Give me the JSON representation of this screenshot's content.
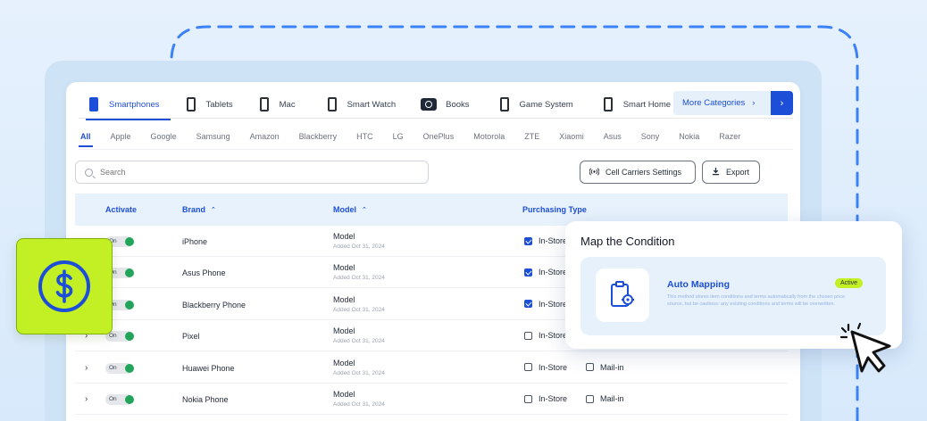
{
  "categories": [
    {
      "label": "Smartphones",
      "icon": "smartphone-icon",
      "active": true
    },
    {
      "label": "Tablets",
      "icon": "tablet-icon"
    },
    {
      "label": "Mac",
      "icon": "mac-icon"
    },
    {
      "label": "Smart Watch",
      "icon": "smartwatch-icon"
    },
    {
      "label": "Books",
      "icon": "camera-icon"
    },
    {
      "label": "Game System",
      "icon": "game-system-icon"
    },
    {
      "label": "Smart Home",
      "icon": "smart-home-icon"
    }
  ],
  "more_categories": {
    "label": "More Categories",
    "chevron": "›",
    "arrow": "›"
  },
  "brands": [
    "All",
    "Apple",
    "Google",
    "Samsung",
    "Amazon",
    "Blackberry",
    "HTC",
    "LG",
    "OnePlus",
    "Motorola",
    "ZTE",
    "Xiaomi",
    "Asus",
    "Sony",
    "Nokia",
    "Razer"
  ],
  "search": {
    "placeholder": "Search"
  },
  "actions": {
    "carrier_settings": "Cell Carriers Settings",
    "export": "Export"
  },
  "table": {
    "headers": {
      "activate": "Activate",
      "brand": "Brand",
      "model": "Model",
      "purchasing_type": "Purchasing Type"
    },
    "rows": [
      {
        "toggle": "On",
        "brand": "iPhone",
        "model": "Model",
        "added": "Added Oct 31, 2024",
        "in_store": true,
        "in_store_label": "In-Store",
        "mail_label": ""
      },
      {
        "toggle": "On",
        "brand": "Asus Phone",
        "model": "Model",
        "added": "Added Oct 31, 2024",
        "in_store": true,
        "in_store_label": "In-Store",
        "mail_label": ""
      },
      {
        "toggle": "On",
        "brand": "Blackberry Phone",
        "model": "Model",
        "added": "Added Oct 31, 2024",
        "in_store": true,
        "in_store_label": "In-Store",
        "mail_label": ""
      },
      {
        "toggle": "On",
        "brand": "Pixel",
        "model": "Model",
        "added": "Added Oct 31, 2024",
        "in_store": false,
        "in_store_label": "In-Store",
        "mail_label": ""
      },
      {
        "toggle": "On",
        "brand": "Huawei Phone",
        "model": "Model",
        "added": "Added Oct 31, 2024",
        "in_store": false,
        "in_store_label": "In-Store",
        "mail_label": "Mail-in"
      },
      {
        "toggle": "On",
        "brand": "Nokia Phone",
        "model": "Model",
        "added": "Added Oct 31, 2024",
        "in_store": false,
        "in_store_label": "In-Store",
        "mail_label": "Mail-in"
      }
    ]
  },
  "popup": {
    "title": "Map the Condition",
    "option_title": "Auto Mapping",
    "badge": "Active",
    "description": "This method stores item conditions and terms automatically from the chosen price source, but be cautious: any existing conditions and terms will be overwritten."
  },
  "colors": {
    "accent": "#1d4ed8",
    "lime": "#c3f024",
    "toggle_green": "#22a55a"
  }
}
